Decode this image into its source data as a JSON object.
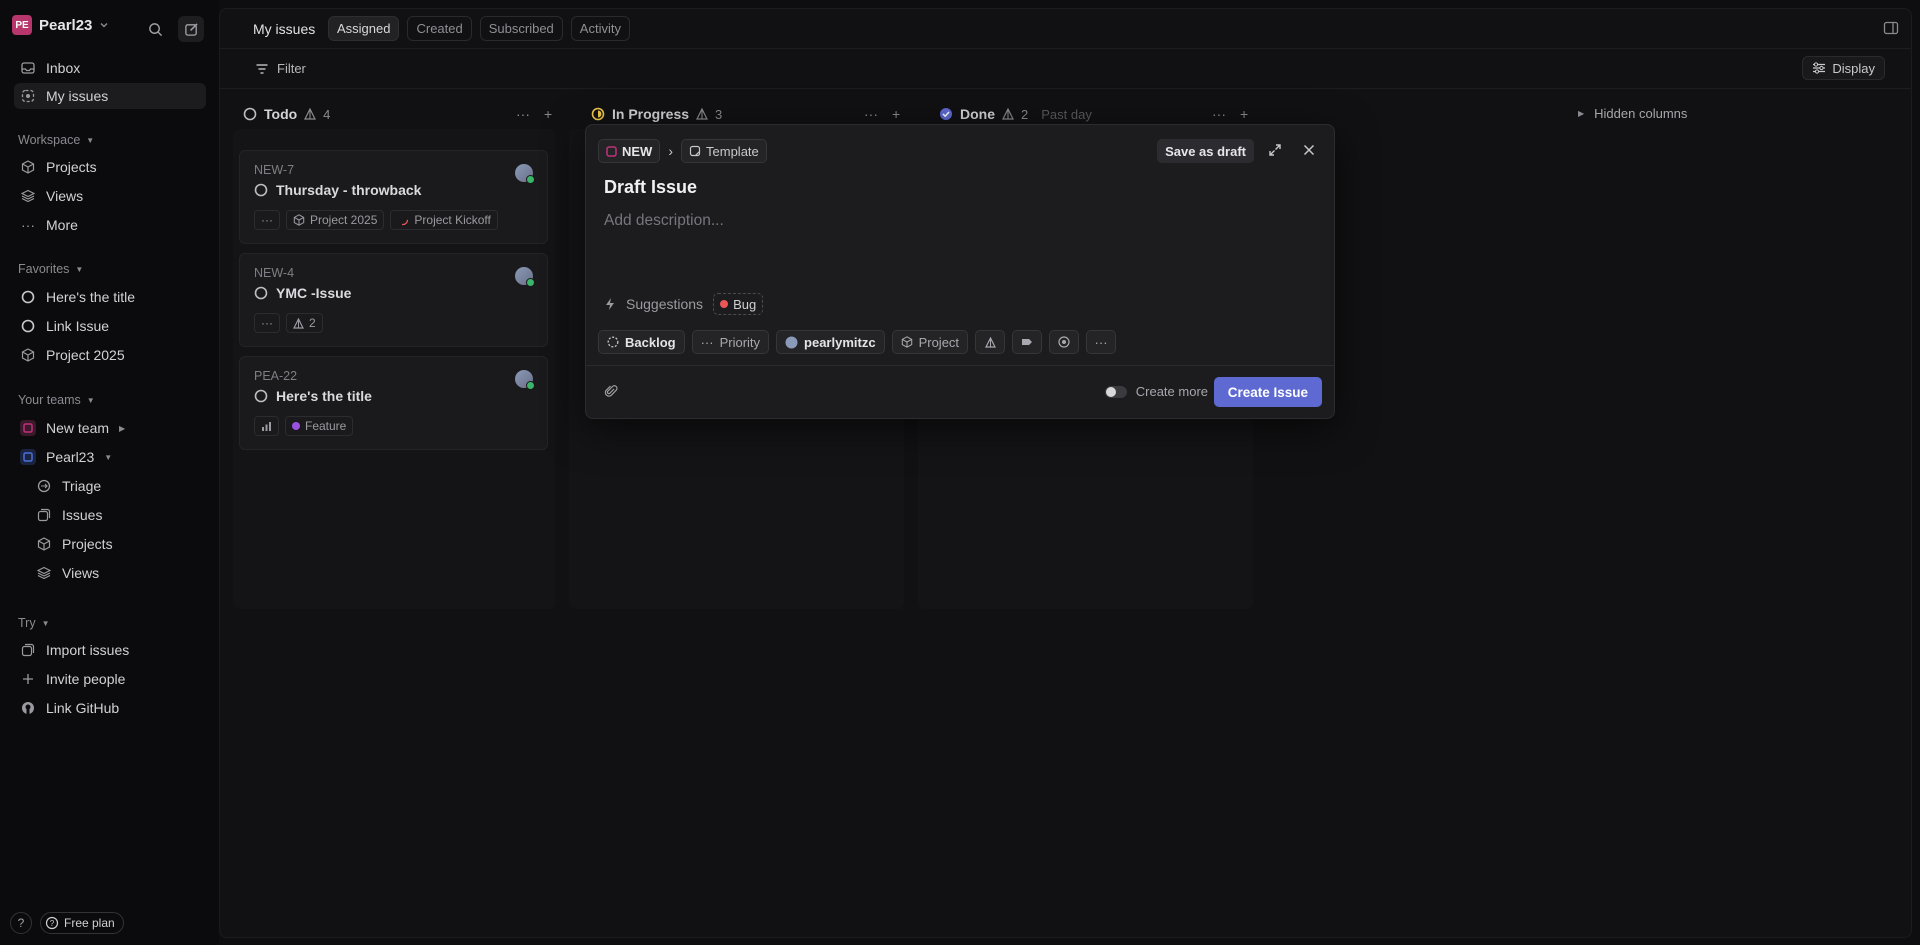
{
  "workspace": {
    "initials": "PE",
    "name": "Pearl23"
  },
  "sidebar": {
    "inbox": "Inbox",
    "my_issues": "My issues",
    "workspace_label": "Workspace",
    "projects": "Projects",
    "views": "Views",
    "more": "More",
    "favorites_label": "Favorites",
    "favorites": [
      "Here's the title",
      "Link Issue",
      "Project 2025"
    ],
    "teams_label": "Your teams",
    "teams": [
      {
        "name": "New team",
        "color": "#c0307a"
      },
      {
        "name": "Pearl23",
        "color": "#4a6fd8"
      }
    ],
    "team_items": [
      "Triage",
      "Issues",
      "Projects",
      "Views"
    ],
    "try_label": "Try",
    "try_items": [
      "Import issues",
      "Invite people",
      "Link GitHub"
    ],
    "help": "?",
    "plan": "Free plan"
  },
  "topbar": {
    "title": "My issues",
    "tabs": [
      "Assigned",
      "Created",
      "Subscribed",
      "Activity"
    ],
    "active_tab": "Assigned"
  },
  "filterbar": {
    "filter": "Filter",
    "display": "Display"
  },
  "columns": [
    {
      "name": "Todo",
      "count": "4",
      "sub": ""
    },
    {
      "name": "In Progress",
      "count": "3",
      "sub": ""
    },
    {
      "name": "Done",
      "count": "2",
      "sub": "Past day"
    }
  ],
  "hidden_columns": "Hidden columns",
  "cards": [
    {
      "id": "NEW-7",
      "title": "Thursday - throwback",
      "tags": [
        "Project 2025",
        "Project Kickoff"
      ]
    },
    {
      "id": "NEW-4",
      "title": "YMC -Issue",
      "tags": [
        "2"
      ]
    },
    {
      "id": "PEA-22",
      "title": "Here's the title",
      "tags": [
        "Feature"
      ]
    }
  ],
  "modal": {
    "team": "NEW",
    "template": "Template",
    "save_draft": "Save as draft",
    "title": "Draft Issue",
    "description_placeholder": "Add description...",
    "suggestions": "Suggestions",
    "suggestion_label": "Bug",
    "props": {
      "status": "Backlog",
      "priority": "Priority",
      "assignee": "pearlymitzc",
      "project": "Project"
    },
    "create_more": "Create more",
    "create": "Create Issue"
  },
  "colors": {
    "accent": "#5e6ad2",
    "bug": "#eb5757",
    "feature": "#9b51e0",
    "in_progress": "#f2c94c",
    "done": "#5e6ad2"
  }
}
